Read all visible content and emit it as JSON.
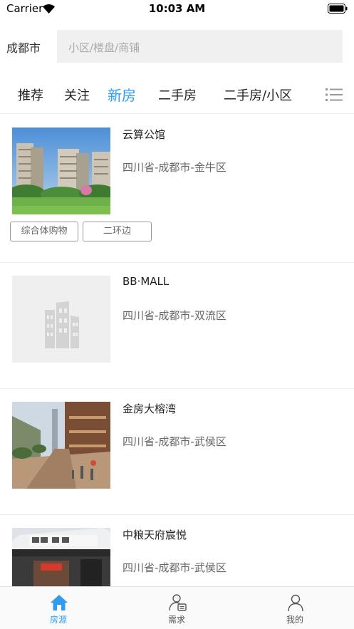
{
  "status_bar": {
    "carrier": "Carrier",
    "time": "10:03 AM"
  },
  "search": {
    "city": "成都市",
    "placeholder": "小区/楼盘/商铺"
  },
  "tabs": [
    {
      "label": "推荐"
    },
    {
      "label": "关注"
    },
    {
      "label": "新房",
      "active": true
    },
    {
      "label": "二手房"
    },
    {
      "label": "二手房/小区"
    }
  ],
  "listings": [
    {
      "name": "云算公馆",
      "address": "四川省-成都市-金牛区",
      "tags": [
        "综合体购物",
        "二环边"
      ],
      "image": "residential-towers"
    },
    {
      "name": "BB·MALL",
      "address": "四川省-成都市-双流区",
      "tags": [],
      "image": "placeholder-building"
    },
    {
      "name": "金房大榕湾",
      "address": "四川省-成都市-武侯区",
      "tags": [],
      "image": "commercial-street"
    },
    {
      "name": "中粮天府宸悦",
      "address": "四川省-成都市-武侯区",
      "tags": [],
      "image": "storefront"
    }
  ],
  "tab_bar": [
    {
      "label": "房源",
      "icon": "home-icon",
      "active": true
    },
    {
      "label": "需求",
      "icon": "demand-icon"
    },
    {
      "label": "我的",
      "icon": "profile-icon"
    }
  ],
  "colors": {
    "accent": "#2e9cf0",
    "search_bg": "#f0f0f0",
    "divider": "#ececec"
  }
}
